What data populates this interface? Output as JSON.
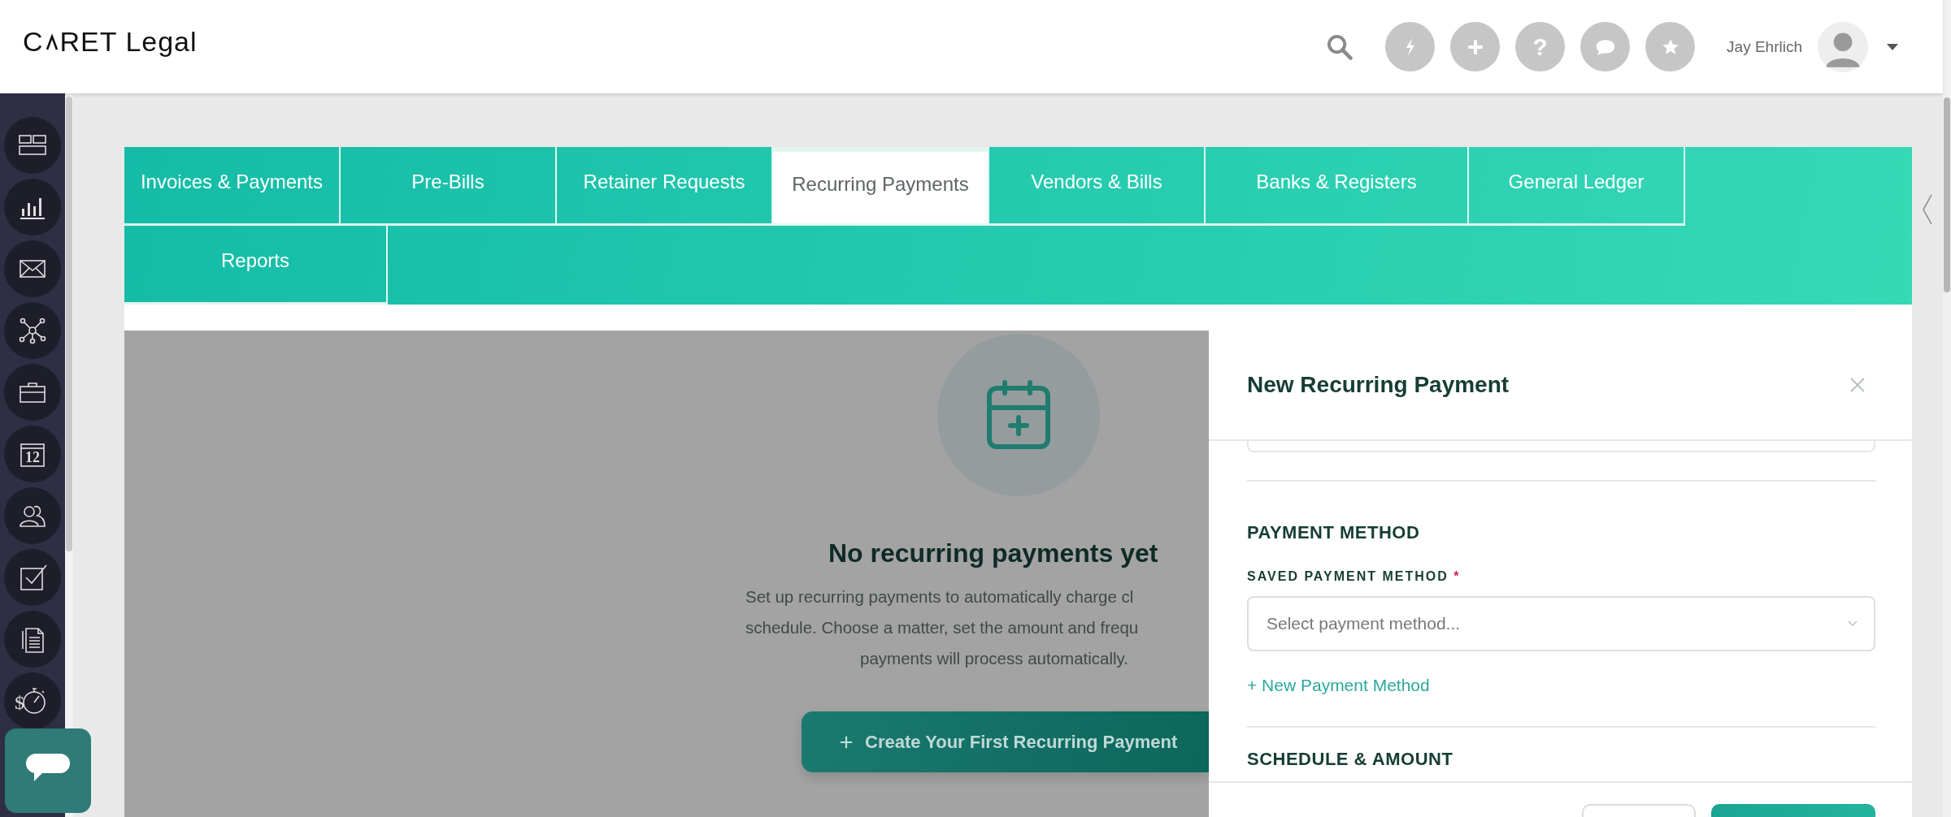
{
  "header": {
    "logo": {
      "start": "C",
      "end": "RET Legal"
    },
    "actions": [
      {
        "kind": "bolt"
      },
      {
        "kind": "plus"
      },
      {
        "kind": "help",
        "label": "?"
      },
      {
        "kind": "chat"
      },
      {
        "kind": "star"
      }
    ],
    "user_name": "Jay Ehrlich"
  },
  "sidebar": {
    "items": [
      {
        "kind": "dashboard"
      },
      {
        "kind": "reports"
      },
      {
        "kind": "mail"
      },
      {
        "kind": "network"
      },
      {
        "kind": "briefcase"
      },
      {
        "kind": "calendar",
        "label": "12"
      },
      {
        "kind": "contacts"
      },
      {
        "kind": "tasks"
      },
      {
        "kind": "documents"
      },
      {
        "kind": "billing",
        "label": "$"
      }
    ]
  },
  "tabs": [
    {
      "label": "Invoices & Payments",
      "selected": false
    },
    {
      "label": "Pre-Bills",
      "selected": false
    },
    {
      "label": "Retainer Requests",
      "selected": false
    },
    {
      "label": "Recurring Payments",
      "selected": true
    },
    {
      "label": "Vendors & Bills",
      "selected": false
    },
    {
      "label": "Banks & Registers",
      "selected": false
    },
    {
      "label": "General Ledger",
      "selected": false
    },
    {
      "label": "Reports",
      "selected": false
    }
  ],
  "empty_state": {
    "title": "No recurring payments yet",
    "lines": [
      "Set up recurring payments to automatically charge cl",
      "schedule. Choose a matter, set the amount and frequ",
      "payments will process automatically."
    ],
    "button": "Create Your First Recurring Payment"
  },
  "modal": {
    "title": "New Recurring Payment",
    "section": "PAYMENT METHOD",
    "field_label": "SAVED PAYMENT METHOD",
    "required_mark": "*",
    "placeholder": "Select payment method...",
    "link": "+ New Payment Method",
    "next_section": "SCHEDULE & AMOUNT"
  }
}
